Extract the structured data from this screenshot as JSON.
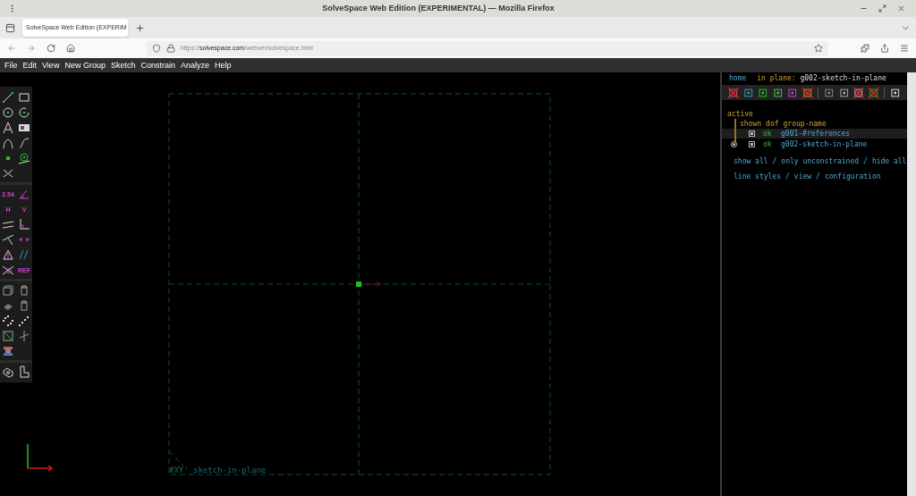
{
  "window": {
    "title": "SolveSpace Web Edition (EXPERIMENTAL) — Mozilla Firefox"
  },
  "tabs": [
    {
      "label": "SolveSpace Web Edition (EXPERIM",
      "selected": true
    }
  ],
  "address_bar": {
    "scheme": "https://",
    "domain": "solvespace.com",
    "path": "/webver/solvespace.html"
  },
  "menu": [
    "File",
    "Edit",
    "View",
    "New Group",
    "Sketch",
    "Constrain",
    "Analyze",
    "Help"
  ],
  "toolbar_groups": [
    [
      {
        "kind": "line"
      },
      {
        "kind": "rectangle"
      },
      {
        "kind": "circle"
      },
      {
        "kind": "arc"
      },
      {
        "kind": "letter"
      },
      {
        "kind": "image"
      },
      {
        "kind": "curve"
      },
      {
        "kind": "spline"
      },
      {
        "kind": "point"
      },
      {
        "kind": "ring"
      },
      {
        "kind": "cross"
      }
    ],
    [
      {
        "kind": "label",
        "label": "2.54"
      },
      {
        "kind": "angle"
      },
      {
        "kind": "label",
        "label": "H"
      },
      {
        "kind": "label",
        "label": "V"
      },
      {
        "kind": "parallel"
      },
      {
        "kind": "perpendicular"
      },
      {
        "kind": "point-on"
      },
      {
        "kind": "arrows"
      },
      {
        "kind": "triangle"
      },
      {
        "kind": "slant"
      },
      {
        "kind": "strike"
      },
      {
        "kind": "label",
        "label": "REF"
      }
    ],
    [
      {
        "kind": "cube"
      },
      {
        "kind": "cylinder"
      },
      {
        "kind": "solid"
      },
      {
        "kind": "cylinder"
      },
      {
        "kind": "dots"
      },
      {
        "kind": "chain"
      },
      {
        "kind": "square"
      },
      {
        "kind": "plane"
      },
      {
        "kind": "stack"
      }
    ],
    [
      {
        "kind": "link"
      },
      {
        "kind": "l-shape"
      }
    ]
  ],
  "text_window": {
    "header": {
      "home": "home",
      "in_plane_label": "in plane:",
      "in_plane": "g002-sketch-in-plane"
    },
    "view_icons": [
      {
        "kind": "workplane",
        "shown": false
      },
      {
        "kind": "normal",
        "shown": true
      },
      {
        "kind": "point",
        "shown": true
      },
      {
        "kind": "constraint",
        "shown": true
      },
      {
        "kind": "construction",
        "shown": true
      },
      {
        "kind": "dimension",
        "shown": false
      },
      {
        "kind": "separator"
      },
      {
        "kind": "shaded",
        "shown": true
      },
      {
        "kind": "edges",
        "shown": true
      },
      {
        "kind": "outline",
        "shown": false
      },
      {
        "kind": "mesh",
        "shown": false
      },
      {
        "kind": "separator"
      },
      {
        "kind": "box",
        "shown": true
      }
    ],
    "active_label": "active",
    "columns": [
      "shown",
      "dof",
      "group-name"
    ],
    "groups": [
      {
        "active": false,
        "shown": true,
        "dof": "ok",
        "name": "g001-#references",
        "selected": true
      },
      {
        "active": true,
        "shown": true,
        "dof": "ok",
        "name": "g002-sketch-in-plane",
        "selected": false
      }
    ],
    "link_lines": [
      [
        {
          "kind": "link",
          "text": "show all"
        },
        {
          "kind": "separator",
          "text": "/"
        },
        {
          "kind": "link",
          "text": "only unconstrained"
        },
        {
          "kind": "separator",
          "text": "/"
        },
        {
          "kind": "link",
          "text": "hide all"
        }
      ],
      [
        {
          "kind": "link",
          "text": "line styles"
        },
        {
          "kind": "separator",
          "text": "/"
        },
        {
          "kind": "link",
          "text": "view"
        },
        {
          "kind": "separator",
          "text": "/"
        },
        {
          "kind": "link",
          "text": "configuration"
        }
      ]
    ]
  },
  "canvas": {
    "workplane_label": "#XY'",
    "group_label": "sketch-in-plane"
  }
}
